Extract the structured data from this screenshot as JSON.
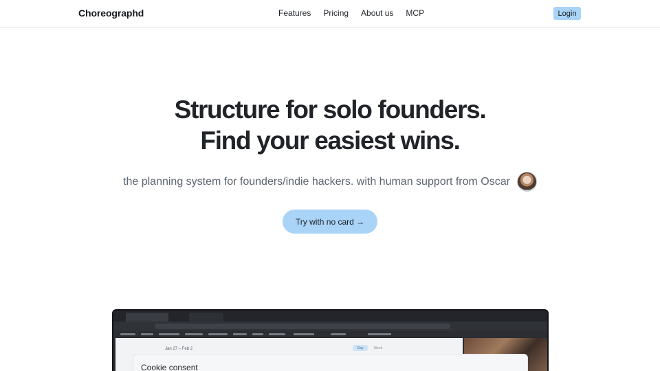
{
  "nav": {
    "brand": "Choreographd",
    "links": [
      "Features",
      "Pricing",
      "About us",
      "MCP"
    ],
    "login_label": "Login"
  },
  "hero": {
    "title_line1": "Structure for solo founders.",
    "title_line2": "Find your easiest wins.",
    "subtitle": "the planning system for founders/indie hackers. with human support from Oscar",
    "cta_label": "Try with no card →"
  },
  "preview": {
    "date_range": "Jan 27 – Feb 2",
    "view_chips": [
      "Day",
      "Week"
    ],
    "cookie_title": "Cookie consent"
  },
  "colors": {
    "accent": "#a9d3f7",
    "title": "#202328",
    "subtitle": "#5b6470",
    "border": "#e3e5e8"
  },
  "icons": {
    "avatar": "founder-avatar-photo"
  }
}
